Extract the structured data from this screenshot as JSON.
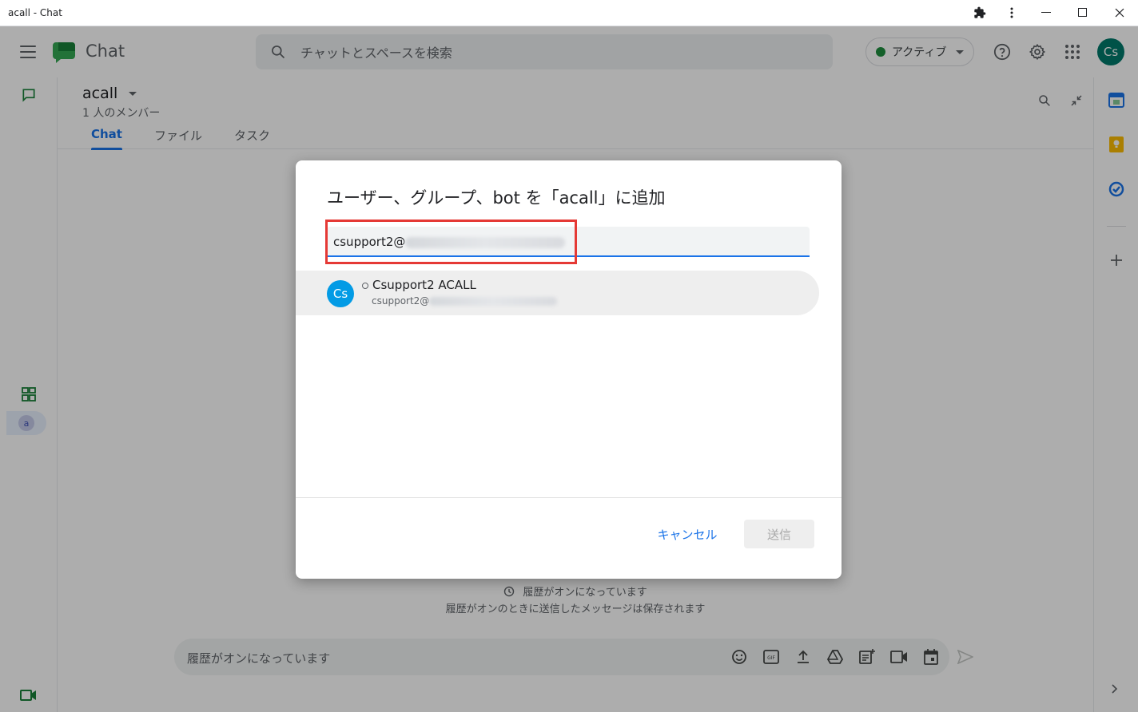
{
  "window": {
    "title": "acall - Chat"
  },
  "header": {
    "app_name": "Chat",
    "search_placeholder": "チャットとスペースを検索",
    "status_label": "アクティブ",
    "avatar_initials": "Cs"
  },
  "space": {
    "name": "acall",
    "members": "1 人のメンバー",
    "tabs": [
      {
        "label": "Chat",
        "active": true
      },
      {
        "label": "ファイル",
        "active": false
      },
      {
        "label": "タスク",
        "active": false
      }
    ]
  },
  "rail": {
    "space_chip_initial": "a"
  },
  "history": {
    "title": "履歴がオンになっています",
    "subtitle": "履歴がオンのときに送信したメッセージは保存されます"
  },
  "composer": {
    "placeholder": "履歴がオンになっています"
  },
  "dialog": {
    "title": "ユーザー、グループ、bot を「acall」に追加",
    "input_value_visible": "csupport2@",
    "suggestion": {
      "initials": "Cs",
      "name": "Csupport2 ACALL",
      "email_visible": "csupport2@"
    },
    "cancel_label": "キャンセル",
    "send_label": "送信"
  },
  "colors": {
    "accent": "#1a73e8",
    "status_green": "#1e8e3e",
    "avatar_teal": "#00796b",
    "suggestion_avatar": "#039be5",
    "highlight_red": "#e53935"
  },
  "icons": {
    "header": [
      "hamburger-menu-icon",
      "search-icon",
      "help-icon",
      "settings-icon",
      "apps-grid-icon"
    ],
    "right_rail": [
      "calendar-icon",
      "keep-icon",
      "tasks-icon",
      "add-icon"
    ],
    "composer": [
      "emoji-icon",
      "gif-icon",
      "upload-icon",
      "drive-icon",
      "doc-icon",
      "video-icon",
      "calendar-icon",
      "send-icon"
    ]
  }
}
